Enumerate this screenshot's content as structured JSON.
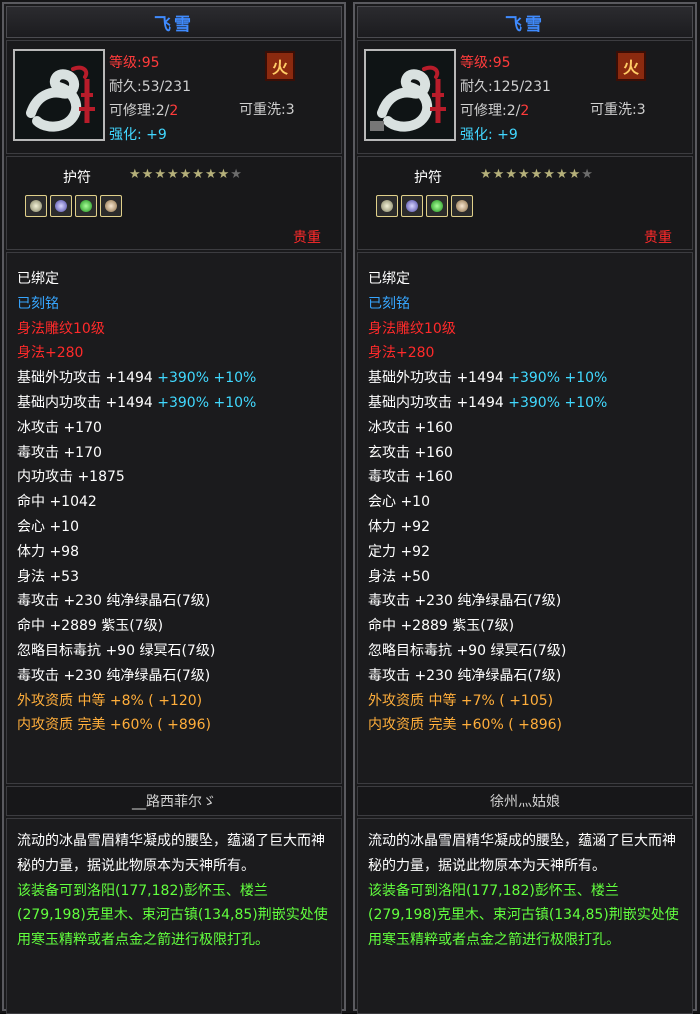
{
  "items": [
    {
      "title": "飞雪",
      "level_label": "等级",
      "level_value": "95",
      "durability_label": "耐久",
      "durability_value": "53/231",
      "repair_label": "可修理",
      "repair_current": "2",
      "repair_max": "2",
      "rewash_label": "可重洗",
      "rewash_value": "3",
      "refine_label": "强化",
      "refine_value": "+9",
      "amulet_label": "护符",
      "stars_filled": 8,
      "stars_total": 9,
      "precious_label": "贵重",
      "bound": "已绑定",
      "engraved": "已刻铭",
      "agility_engrave": "身法雕纹10级",
      "agility_bonus": "身法+280",
      "attack_lines": [
        {
          "label": "基础外功攻击",
          "value": "+1494",
          "pct1": "+390%",
          "pct2": "+10%"
        },
        {
          "label": "基础内功攻击",
          "value": "+1494",
          "pct1": "+390%",
          "pct2": "+10%"
        }
      ],
      "white_lines": [
        "冰攻击 +170",
        "毒攻击 +170",
        "内功攻击 +1875",
        "命中 +1042",
        "会心 +10",
        "体力 +98",
        "身法 +53",
        "毒攻击 +230 纯净绿晶石(7级)",
        "命中 +2889 紫玉(7级)",
        "忽略目标毒抗 +90 绿冥石(7级)",
        "毒攻击 +230 纯净绿晶石(7级)"
      ],
      "orange_lines": [
        "外攻资质   中等 +8% ( +120)",
        "内攻资质   完美 +60% ( +896)"
      ],
      "owner_name": "__路西菲尔ゞ",
      "desc_white": "流动的冰晶雪眉精华凝成的腰坠，蕴涵了巨大而神秘的力量，据说此物原本为天神所有。",
      "desc_green": "该装备可到洛阳(177,182)彭怀玉、楼兰(279,198)克里木、束河古镇(134,85)荆嵌实处使用寒玉精粹或者点金之箭进行极限打孔。"
    },
    {
      "title": "飞雪",
      "level_label": "等级",
      "level_value": "95",
      "durability_label": "耐久",
      "durability_value": "125/231",
      "repair_label": "可修理",
      "repair_current": "2",
      "repair_max": "2",
      "rewash_label": "可重洗",
      "rewash_value": "3",
      "refine_label": "强化",
      "refine_value": "+9",
      "amulet_label": "护符",
      "stars_filled": 8,
      "stars_total": 9,
      "precious_label": "贵重",
      "bound": "已绑定",
      "engraved": "已刻铭",
      "agility_engrave": "身法雕纹10级",
      "agility_bonus": "身法+280",
      "attack_lines": [
        {
          "label": "基础外功攻击",
          "value": "+1494",
          "pct1": "+390%",
          "pct2": "+10%"
        },
        {
          "label": "基础内功攻击",
          "value": "+1494",
          "pct1": "+390%",
          "pct2": "+10%"
        }
      ],
      "white_lines": [
        "冰攻击 +160",
        "玄攻击 +160",
        "毒攻击 +160",
        "会心 +10",
        "体力 +92",
        "定力 +92",
        "身法 +50",
        "毒攻击 +230 纯净绿晶石(7级)",
        "命中 +2889 紫玉(7级)",
        "忽略目标毒抗 +90 绿冥石(7级)",
        "毒攻击 +230 纯净绿晶石(7级)"
      ],
      "orange_lines": [
        "外攻资质   中等 +7% ( +105)",
        "内攻资质   完美 +60% ( +896)"
      ],
      "owner_name": "徐州灬姑娘",
      "desc_white": "流动的冰晶雪眉精华凝成的腰坠，蕴涵了巨大而神秘的力量，据说此物原本为天神所有。",
      "desc_green": "该装备可到洛阳(177,182)彭怀玉、楼兰(279,198)克里木、束河古镇(134,85)荆嵌实处使用寒玉精粹或者点金之箭进行极限打孔。"
    }
  ],
  "colors": {
    "title_blue": "#3f8bff",
    "red": "#ff2a2a",
    "cyan": "#41d9ff",
    "orange": "#ffae3b",
    "green": "#62ff3e"
  }
}
